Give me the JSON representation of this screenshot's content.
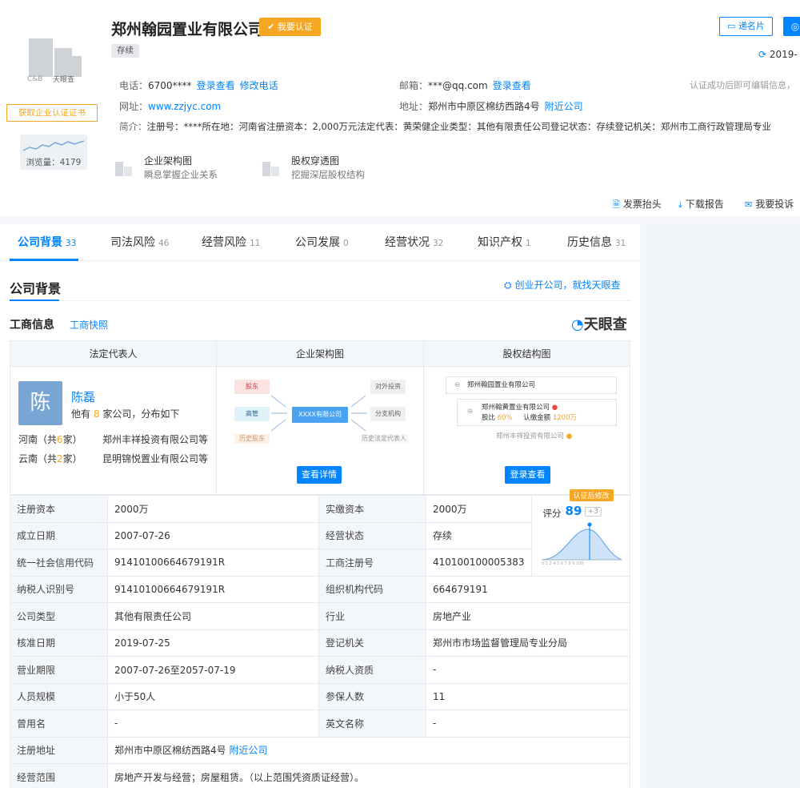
{
  "company": {
    "name": "郑州翰园置业有限公司",
    "verify_label": "我要认证",
    "status_tag": "存续",
    "logo_text": "C&B",
    "logo_brand": "天眼查",
    "cert_button": "获取企业认证证书",
    "views_label": "浏览量：4179"
  },
  "contact": {
    "phone_label": "电话：",
    "phone_value": "6700****",
    "phone_login": "登录查看",
    "phone_edit": "修改电话",
    "email_label": "邮箱：",
    "email_value": "***@qq.com",
    "email_login": "登录查看",
    "web_label": "网址：",
    "web_value": "www.zzjyc.com",
    "addr_label": "地址：",
    "addr_value": "郑州市中原区棉纺西路4号",
    "addr_nearby": "附近公司",
    "intro_label": "简介：",
    "intro_value": "注册号：****所在地：河南省注册资本：2,000万元法定代表：黄荣健企业类型：其他有限责任公司登记状态：存续登记机关：郑州市工商行政管理局专业",
    "note_right": "认证成功后即可编辑信息，"
  },
  "header_right": {
    "biz_card": "递名片",
    "date": "2019-"
  },
  "entries": [
    {
      "title": "企业架构图",
      "sub": "瞬息掌握企业关系"
    },
    {
      "title": "股权穿透图",
      "sub": "挖掘深层股权结构"
    }
  ],
  "actions": {
    "invoice": "发票抬头",
    "download": "下载报告",
    "complaint": "我要投诉"
  },
  "tabs": [
    {
      "label": "公司背景",
      "count": "33"
    },
    {
      "label": "司法风险",
      "count": "46"
    },
    {
      "label": "经营风险",
      "count": "11"
    },
    {
      "label": "公司发展",
      "count": "0"
    },
    {
      "label": "经营状况",
      "count": "32"
    },
    {
      "label": "知识产权",
      "count": "1"
    },
    {
      "label": "历史信息",
      "count": "31"
    }
  ],
  "section": {
    "title": "公司背景",
    "promo": "创业开公司，就找天眼查",
    "sub_title": "工商信息",
    "sub_link": "工商快照",
    "brand_prefix": "天",
    "brand_rest": "眼查"
  },
  "panels": {
    "legal_header": "法定代表人",
    "org_header": "企业架构图",
    "equity_header": "股权结构图",
    "avatar_char": "陈",
    "person_name": "陈磊",
    "person_desc_a": "他有",
    "person_desc_n": "8",
    "person_desc_b": "家公司，分布如下",
    "regions": [
      {
        "region": "河南（共",
        "n": "6",
        "tail": "家）",
        "company": "郑州丰祥投资有限公司等"
      },
      {
        "region": "云南（共",
        "n": "2",
        "tail": "家）",
        "company": "昆明锦悦置业有限公司等"
      }
    ],
    "org_boxes": {
      "shareholder": "股东",
      "manager": "高管",
      "center": "XXXX有限公司",
      "invest": "对外投资",
      "branch": "分支机构",
      "hist1": "历史股东",
      "hist2": "历史法定代表人"
    },
    "org_button": "查看详情",
    "equity": {
      "root": "郑州翰园置业有限公司",
      "child": "郑州翰黄置业有限公司",
      "ratio_label": "股比",
      "ratio": "60%",
      "amount_label": "认缴金额",
      "amount": "1200万",
      "grandchild": "郑州丰祥投资有限公司"
    },
    "equity_button": "登录查看"
  },
  "info_rows": [
    {
      "k1": "注册资本",
      "v1": "2000万",
      "k2": "实缴资本",
      "v2": "2000万"
    },
    {
      "k1": "成立日期",
      "v1": "2007-07-26",
      "k2": "经营状态",
      "v2": "存续"
    },
    {
      "k1": "统一社会信用代码",
      "v1": "91410100664679191R",
      "k2": "工商注册号",
      "v2": "410100100005383"
    },
    {
      "k1": "纳税人识别号",
      "v1": "91410100664679191R",
      "k2": "组织机构代码",
      "v2": "664679191"
    },
    {
      "k1": "公司类型",
      "v1": "其他有限责任公司",
      "k2": "行业",
      "v2": "房地产业"
    },
    {
      "k1": "核准日期",
      "v1": "2019-07-25",
      "k2": "登记机关",
      "v2": "郑州市市场监督管理局专业分局"
    },
    {
      "k1": "营业期限",
      "v1": "2007-07-26至2057-07-19",
      "k2": "纳税人资质",
      "v2": "-"
    },
    {
      "k1": "人员规模",
      "v1": "小于50人",
      "k2": "参保人数",
      "v2": "11"
    },
    {
      "k1": "曾用名",
      "v1": "-",
      "k2": "英文名称",
      "v2": "-"
    }
  ],
  "address_row": {
    "k": "注册地址",
    "v": "郑州市中原区棉纺西路4号",
    "link": "附近公司"
  },
  "scope_row": {
    "k": "经营范围",
    "v": "房地产开发与经营；房屋租赁。（以上范围凭资质证经营）。"
  },
  "score": {
    "label": "评分",
    "value": "89",
    "plus": "+3",
    "tag": "认证后修改",
    "axis": [
      "0",
      "1",
      "2",
      "4",
      "5",
      "6",
      "7",
      "8",
      "9",
      "100"
    ]
  }
}
